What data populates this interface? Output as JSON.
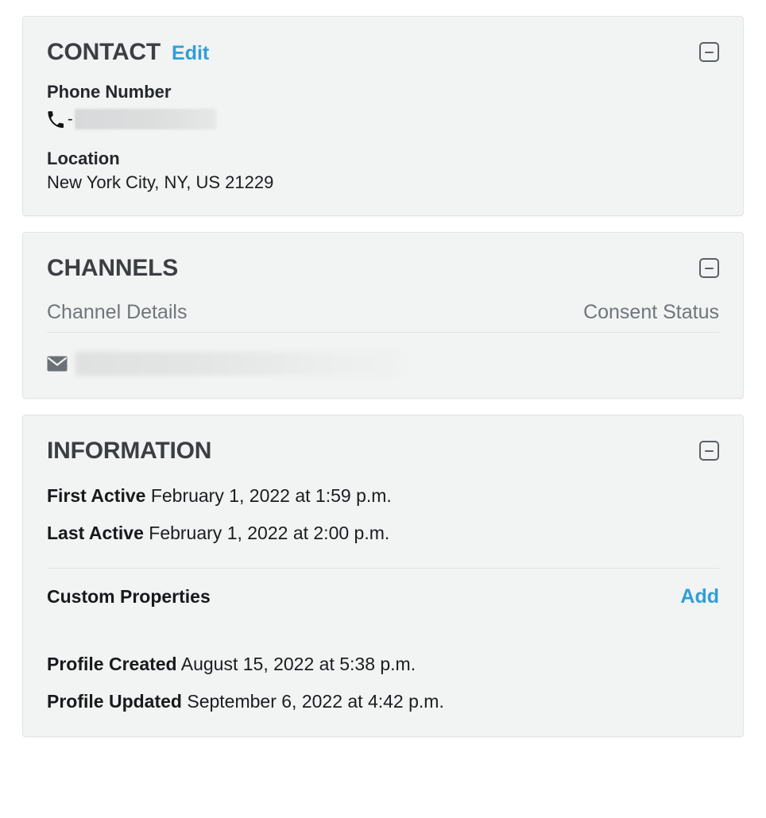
{
  "contact": {
    "title": "CONTACT",
    "edit_label": "Edit",
    "collapse_icon": "collapse-minus-icon",
    "phone": {
      "label": "Phone Number",
      "icon": "phone-icon",
      "prefix": "-",
      "value": "",
      "redacted": true
    },
    "location": {
      "label": "Location",
      "value": "New York City, NY, US 21229"
    }
  },
  "channels": {
    "title": "CHANNELS",
    "collapse_icon": "collapse-minus-icon",
    "columns": {
      "details": "Channel Details",
      "consent": "Consent Status"
    },
    "rows": [
      {
        "icon": "email-icon",
        "value": "",
        "redacted": true,
        "consent": ""
      }
    ]
  },
  "information": {
    "title": "INFORMATION",
    "collapse_icon": "collapse-minus-icon",
    "first_active": {
      "label": "First Active",
      "value": "February 1, 2022 at 1:59 p.m."
    },
    "last_active": {
      "label": "Last Active",
      "value": "February 1, 2022 at 2:00 p.m."
    },
    "custom_properties": {
      "label": "Custom Properties",
      "add_label": "Add"
    },
    "profile_created": {
      "label": "Profile Created",
      "value": "August 15, 2022 at 5:38 p.m."
    },
    "profile_updated": {
      "label": "Profile Updated",
      "value": "September 6, 2022 at 4:42 p.m."
    }
  },
  "colors": {
    "link": "#2f9fd8",
    "panel_bg": "#f2f3f3",
    "heading": "#3b3f42",
    "muted": "#6f767b"
  }
}
